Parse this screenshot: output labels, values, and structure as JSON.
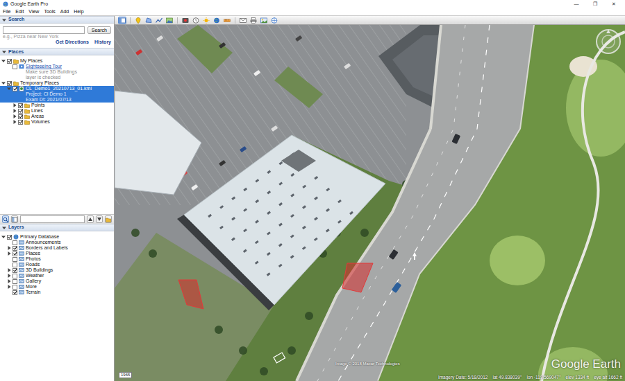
{
  "window": {
    "title": "Google Earth Pro",
    "controls": [
      "—",
      "❐",
      "✕"
    ]
  },
  "menu": [
    "File",
    "Edit",
    "View",
    "Tools",
    "Add",
    "Help"
  ],
  "toolbar": [
    {
      "kind": "sidebar",
      "selected": true
    },
    {
      "kind": "placemark",
      "selected": false
    },
    {
      "kind": "polygon",
      "selected": false
    },
    {
      "kind": "path",
      "selected": false
    },
    {
      "kind": "overlay",
      "selected": false
    },
    {
      "kind": "tour",
      "selected": false
    },
    {
      "kind": "history",
      "selected": false
    },
    {
      "kind": "sun",
      "selected": false
    },
    {
      "kind": "planet",
      "selected": false
    },
    {
      "kind": "ruler",
      "selected": false
    },
    {
      "kind": "email",
      "selected": false
    },
    {
      "kind": "print",
      "selected": false
    },
    {
      "kind": "save-image",
      "selected": false
    },
    {
      "kind": "maps",
      "selected": false
    }
  ],
  "search": {
    "title": "Search",
    "expanded": true,
    "hint": "e.g., Pizza near New York",
    "button": "Search",
    "links": [
      "Get Directions",
      "History"
    ]
  },
  "places": {
    "title": "Places",
    "expanded": true,
    "items": [
      {
        "label": "My Places",
        "depth": 0,
        "expandable": true,
        "expanded": true,
        "checked": true,
        "selected": false,
        "kind": "folder",
        "note": []
      },
      {
        "label": "Sightseeing Tour",
        "depth": 1,
        "expandable": false,
        "expanded": false,
        "checked": false,
        "selected": false,
        "kind": "tour",
        "note": [
          "Make sure 3D Buildings",
          "layer is checked"
        ]
      },
      {
        "label": "Temporary Places",
        "depth": 0,
        "expandable": true,
        "expanded": true,
        "checked": true,
        "selected": false,
        "kind": "folder",
        "note": []
      },
      {
        "label": "CL_Demo1_20210713_01.kml",
        "depth": 1,
        "expandable": true,
        "expanded": true,
        "checked": true,
        "selected": true,
        "kind": "kml",
        "note": [
          "Project: Cl Demo 1",
          "Exam Dt: 2021/07/13"
        ]
      },
      {
        "label": "Points",
        "depth": 2,
        "expandable": true,
        "expanded": false,
        "checked": true,
        "selected": false,
        "kind": "folder",
        "note": []
      },
      {
        "label": "Lines",
        "depth": 2,
        "expandable": true,
        "expanded": false,
        "checked": true,
        "selected": false,
        "kind": "folder",
        "note": []
      },
      {
        "label": "Areas",
        "depth": 2,
        "expandable": true,
        "expanded": false,
        "checked": true,
        "selected": false,
        "kind": "folder",
        "note": []
      },
      {
        "label": "Volumes",
        "depth": 2,
        "expandable": true,
        "expanded": false,
        "checked": true,
        "selected": false,
        "kind": "folder",
        "note": []
      }
    ]
  },
  "layers": {
    "title": "Layers",
    "expanded": true,
    "items": [
      {
        "label": "Primary Database",
        "depth": 0,
        "expandable": true,
        "expanded": true,
        "checked": true,
        "selected": false,
        "kind": "database",
        "note": []
      },
      {
        "label": "Announcements",
        "depth": 1,
        "expandable": false,
        "expanded": false,
        "checked": false,
        "selected": false,
        "kind": "layer",
        "note": []
      },
      {
        "label": "Borders and Labels",
        "depth": 1,
        "expandable": true,
        "expanded": false,
        "checked": true,
        "selected": false,
        "kind": "layer",
        "note": []
      },
      {
        "label": "Places",
        "depth": 1,
        "expandable": true,
        "expanded": false,
        "checked": true,
        "selected": false,
        "kind": "layer",
        "note": []
      },
      {
        "label": "Photos",
        "depth": 1,
        "expandable": false,
        "expanded": false,
        "checked": false,
        "selected": false,
        "kind": "layer",
        "note": []
      },
      {
        "label": "Roads",
        "depth": 1,
        "expandable": false,
        "expanded": false,
        "checked": false,
        "selected": false,
        "kind": "layer",
        "note": []
      },
      {
        "label": "3D Buildings",
        "depth": 1,
        "expandable": true,
        "expanded": false,
        "checked": true,
        "selected": false,
        "kind": "layer",
        "note": []
      },
      {
        "label": "Weather",
        "depth": 1,
        "expandable": true,
        "expanded": false,
        "checked": false,
        "selected": false,
        "kind": "layer",
        "note": []
      },
      {
        "label": "Gallery",
        "depth": 1,
        "expandable": true,
        "expanded": false,
        "checked": false,
        "selected": false,
        "kind": "layer",
        "note": []
      },
      {
        "label": "More",
        "depth": 1,
        "expandable": true,
        "expanded": false,
        "checked": false,
        "selected": false,
        "kind": "layer",
        "note": []
      },
      {
        "label": "Terrain",
        "depth": 1,
        "expandable": false,
        "expanded": false,
        "checked": true,
        "selected": false,
        "kind": "layer",
        "note": []
      }
    ]
  },
  "map": {
    "copyright": "Image © 2018 Maxar Technologies",
    "logo": "Google Earth",
    "badge": "1965",
    "status": [
      "Imagery Date: 5/18/2012",
      "lat 49.838039°",
      "lon -119.569047°",
      "elev 1334 ft",
      "eye alt 1662 ft"
    ]
  }
}
